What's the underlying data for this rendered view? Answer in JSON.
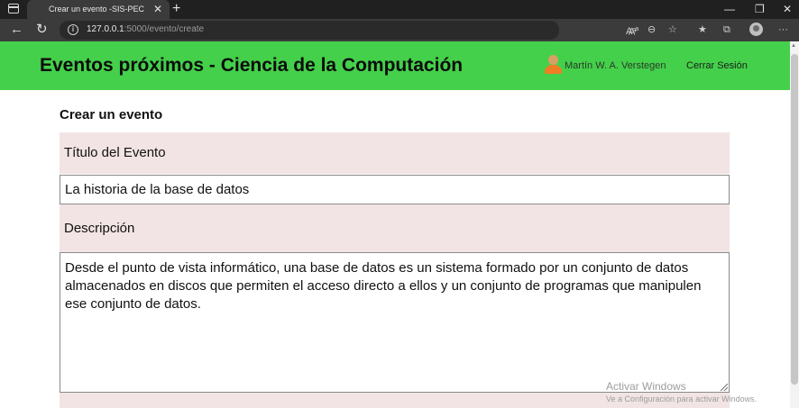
{
  "browser": {
    "tab_title": "Crear un evento -SIS-PEC",
    "url_host": "127.0.0.1",
    "url_path": ":5000/evento/create",
    "icons": {
      "window_menu": "window-icon",
      "close_tab": "close-icon",
      "new_tab": "plus-icon",
      "back": "back-arrow-icon",
      "reload": "reload-icon",
      "site_info": "info-icon",
      "read_aloud": "read-aloud-icon",
      "zoom": "zoom-icon",
      "add_favorite": "star-plus-icon",
      "favorites": "favorites-icon",
      "collections": "collections-icon",
      "profile": "profile-icon",
      "more": "more-icon"
    }
  },
  "header": {
    "title": "Eventos próximos - Ciencia de la Computación",
    "user_name": "Martín W. A. Verstegen",
    "logout_label": "Cerrar Sesión",
    "background": "#44d04a"
  },
  "form": {
    "heading": "Crear un evento",
    "title_label": "Título del Evento",
    "title_value": "La historia de la base de datos",
    "description_label": "Descripción",
    "description_value": "Desde el punto de vista informático, una base de datos es un sistema formado por un conjunto de datos almacenados en discos que permiten el acceso directo a ellos y un conjunto de programas que manipulen ese conjunto de datos.",
    "label_background": "#f2e4e4"
  },
  "watermark": {
    "line1": "Activar Windows",
    "line2": "Ve a Configuración para activar Windows."
  }
}
